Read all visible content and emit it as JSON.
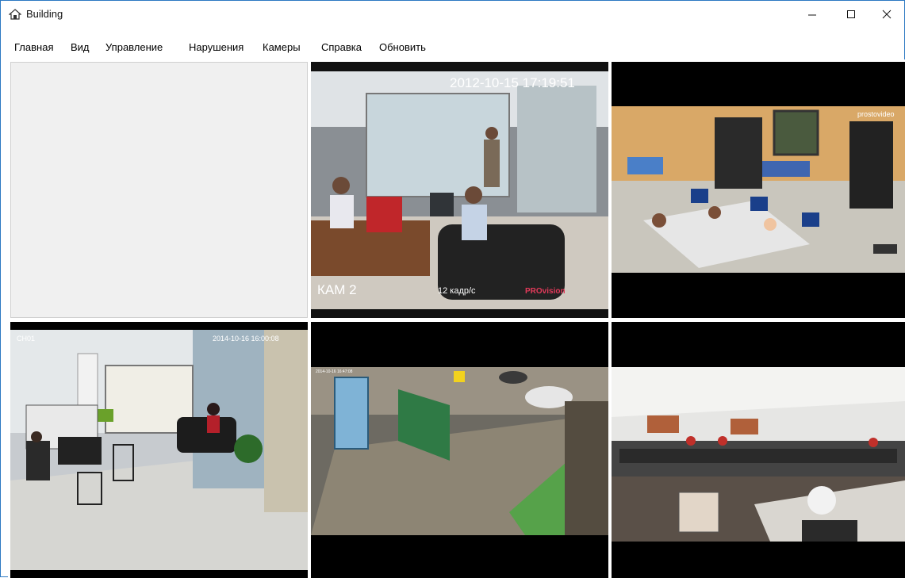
{
  "window": {
    "title": "Building"
  },
  "menu": {
    "items": [
      "Главная",
      "Вид",
      "Управление",
      "Нарушения",
      "Камеры",
      "Справка",
      "Обновить"
    ]
  },
  "cameras": [
    {
      "slot": 1,
      "empty": true
    },
    {
      "slot": 2,
      "timestamp": "2012-10-15 17:19:51",
      "name": "КАМ 2",
      "fps": "12 кадр/с",
      "brand": "PROvision"
    },
    {
      "slot": 3,
      "logo_text": "prostovideo"
    },
    {
      "slot": 4,
      "channel": "CH01",
      "timestamp": "2014-10-16 16:00:08"
    },
    {
      "slot": 5,
      "timestamp": "2014-10-16 16:47:08"
    },
    {
      "slot": 6
    }
  ],
  "colors": {
    "window_border": "#2b78c2",
    "empty_cell": "#f0f0f0",
    "video_bg": "#000000"
  }
}
